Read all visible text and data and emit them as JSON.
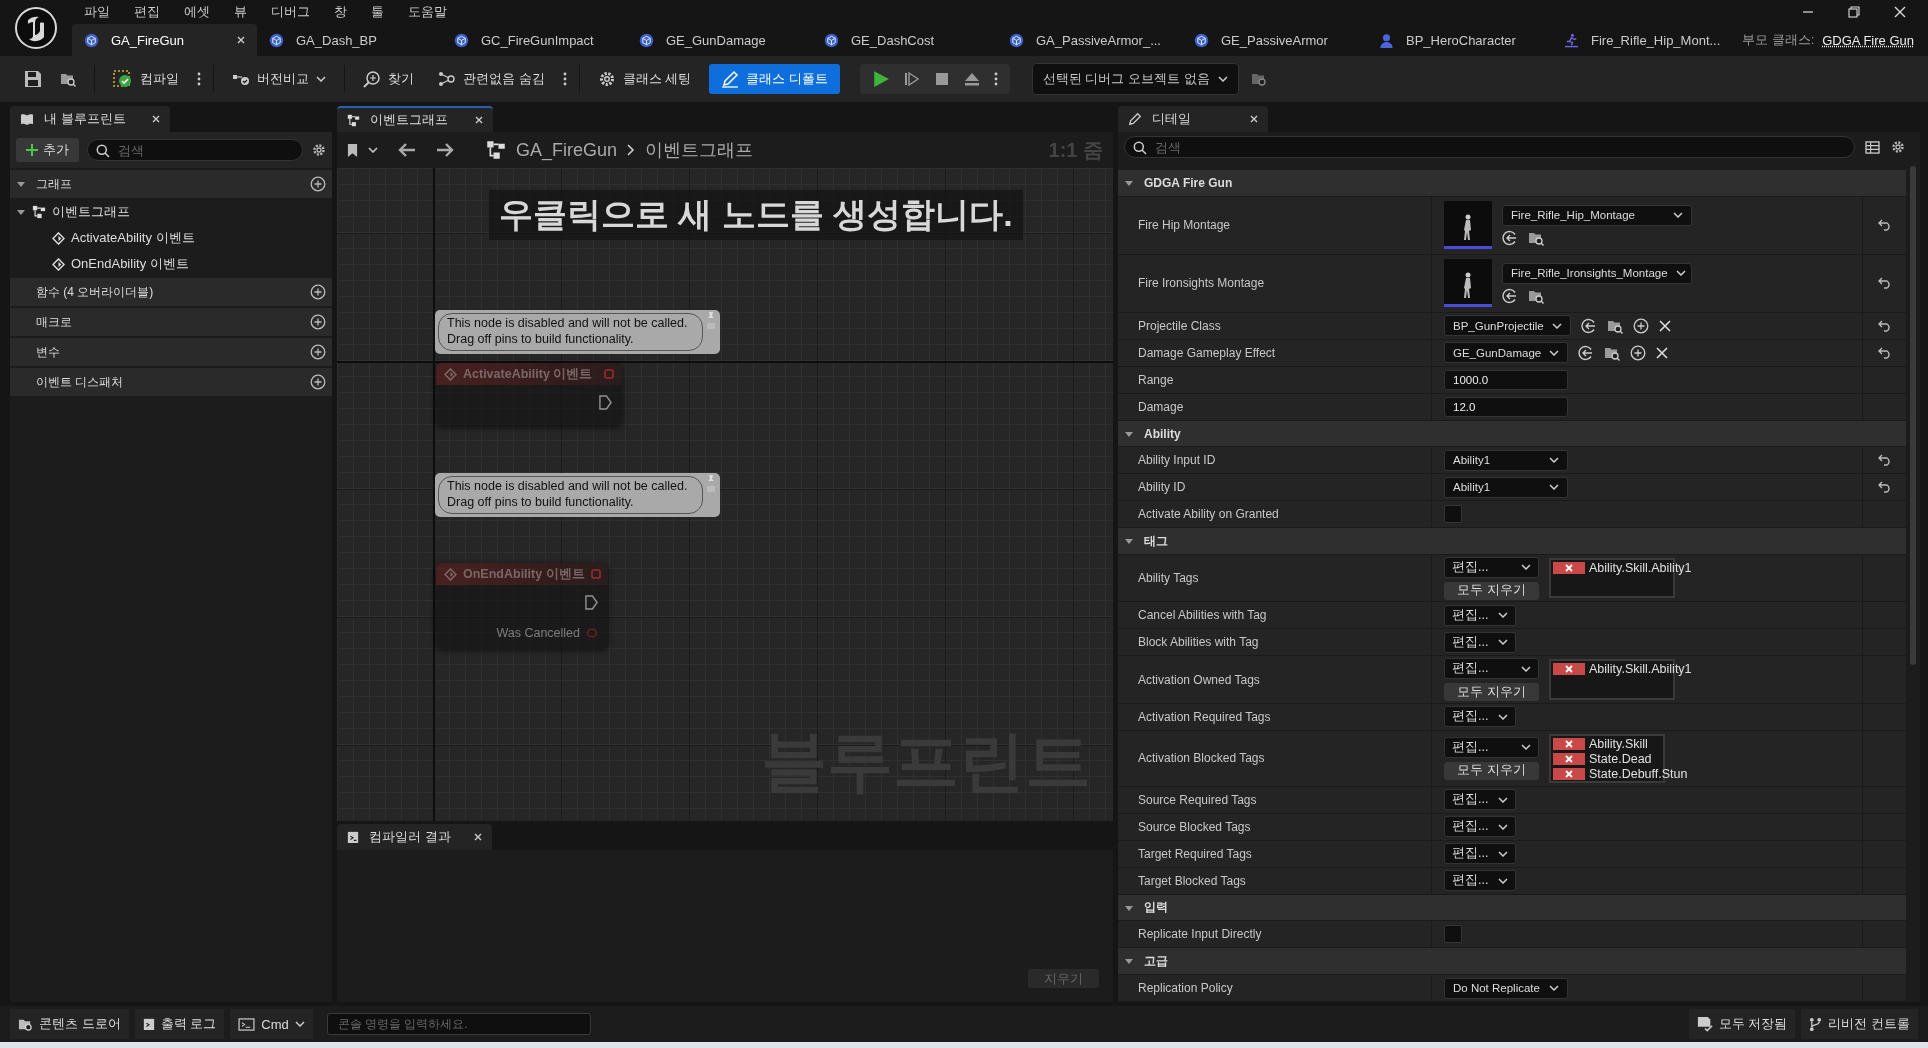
{
  "menu": [
    "파일",
    "편집",
    "에셋",
    "뷰",
    "디버그",
    "창",
    "툴",
    "도움말"
  ],
  "document_tabs": [
    {
      "label": "GA_FireGun",
      "kind": "blueprint",
      "selected": true
    },
    {
      "label": "GA_Dash_BP",
      "kind": "blueprint",
      "selected": false
    },
    {
      "label": "GC_FireGunImpact",
      "kind": "blueprint",
      "selected": false
    },
    {
      "label": "GE_GunDamage",
      "kind": "blueprint",
      "selected": false
    },
    {
      "label": "GE_DashCost",
      "kind": "blueprint",
      "selected": false
    },
    {
      "label": "GA_PassiveArmor_...",
      "kind": "blueprint",
      "selected": false
    },
    {
      "label": "GE_PassiveArmor",
      "kind": "blueprint",
      "selected": false
    },
    {
      "label": "BP_HeroCharacter",
      "kind": "character",
      "selected": false
    },
    {
      "label": "Fire_Rifle_Hip_Mont...",
      "kind": "montage",
      "selected": false
    }
  ],
  "parent_class": {
    "label": "부모 클래스:",
    "link": "GDGA Fire Gun"
  },
  "toolbar": {
    "compile": "컴파일",
    "diff": "버전비교",
    "find": "찾기",
    "hide_unrelated": "관련없음 숨김",
    "class_settings": "클래스 세팅",
    "class_defaults": {
      "label": "클래스 디폴트",
      "selected": true
    },
    "debug_object": "선택된 디버그 오브젝트 없음"
  },
  "my_blueprint": {
    "tab": "내 블루프린트",
    "add": "추가",
    "search_placeholder": "검색",
    "sections": [
      {
        "label": "그래프",
        "expanded": true,
        "children": [
          {
            "label": "이벤트그래프",
            "expanded": true,
            "children": [
              {
                "label": "ActivateAbility 이벤트"
              },
              {
                "label": "OnEndAbility 이벤트"
              }
            ]
          }
        ]
      },
      {
        "label": "함수 (4 오버라이더블)"
      },
      {
        "label": "매크로"
      },
      {
        "label": "변수"
      },
      {
        "label": "이벤트 디스패처"
      }
    ]
  },
  "graph": {
    "tab": "이벤트그래프",
    "breadcrumb": [
      "GA_FireGun",
      "이벤트그래프"
    ],
    "zoom": "1:1 줌",
    "hint": "우클릭으로 새 노드를 생성합니다.",
    "corner_label": "블루프린트",
    "nodes": [
      {
        "title": "ActivateAbility 이벤트",
        "comment": [
          "This node is disabled and will not be called.",
          "Drag off pins to build functionality."
        ],
        "disabled": true
      },
      {
        "title": "OnEndAbility 이벤트",
        "comment": [
          "This node is disabled and will not be called.",
          "Drag off pins to build functionality."
        ],
        "disabled": true,
        "pins": [
          "Was Cancelled"
        ]
      }
    ]
  },
  "compiler_results": {
    "tab": "컴파일러 결과",
    "clear": "지우기"
  },
  "details": {
    "tab": "디테일",
    "search_placeholder": "검색",
    "sections": [
      {
        "title": "GDGA Fire Gun",
        "expanded": true,
        "rows": [
          {
            "label": "Fire Hip Montage",
            "kind": "asset",
            "value": "Fire_Rifle_Hip_Montage",
            "resettable": true
          },
          {
            "label": "Fire Ironsights Montage",
            "kind": "asset",
            "value": "Fire_Rifle_Ironsights_Montage",
            "resettable": true
          },
          {
            "label": "Projectile Class",
            "kind": "class",
            "value": "BP_GunProjectile",
            "resettable": true
          },
          {
            "label": "Damage Gameplay Effect",
            "kind": "class",
            "value": "GE_GunDamage",
            "resettable": true
          },
          {
            "label": "Range",
            "kind": "number",
            "value": "1000.0",
            "resettable": false
          },
          {
            "label": "Damage",
            "kind": "number",
            "value": "12.0",
            "resettable": false
          }
        ]
      },
      {
        "title": "Ability",
        "expanded": true,
        "rows": [
          {
            "label": "Ability Input ID",
            "kind": "enum",
            "value": "Ability1",
            "resettable": true
          },
          {
            "label": "Ability ID",
            "kind": "enum",
            "value": "Ability1",
            "resettable": true
          },
          {
            "label": "Activate Ability on Granted",
            "kind": "checkbox",
            "checked": false,
            "resettable": false
          }
        ]
      },
      {
        "title": "태그",
        "expanded": true,
        "rows": [
          {
            "label": "Ability Tags",
            "kind": "tags",
            "edit": "편집...",
            "tags": [
              "Ability.Skill.Ability1"
            ],
            "clear": "모두 지우기",
            "resettable": false
          },
          {
            "label": "Cancel Abilities with Tag",
            "kind": "tags",
            "edit": "편집...",
            "resettable": false
          },
          {
            "label": "Block Abilities with Tag",
            "kind": "tags",
            "edit": "편집...",
            "resettable": false
          },
          {
            "label": "Activation Owned Tags",
            "kind": "tags",
            "edit": "편집...",
            "tags": [
              "Ability.Skill.Ability1"
            ],
            "clear": "모두 지우기",
            "resettable": false
          },
          {
            "label": "Activation Required Tags",
            "kind": "tags",
            "edit": "편집...",
            "resettable": false
          },
          {
            "label": "Activation Blocked Tags",
            "kind": "tags",
            "edit": "편집...",
            "tags": [
              "Ability.Skill",
              "State.Dead",
              "State.Debuff.Stun"
            ],
            "clear": "모두 지우기",
            "resettable": false
          },
          {
            "label": "Source Required Tags",
            "kind": "tags",
            "edit": "편집...",
            "resettable": false
          },
          {
            "label": "Source Blocked Tags",
            "kind": "tags",
            "edit": "편집...",
            "resettable": false
          },
          {
            "label": "Target Required Tags",
            "kind": "tags",
            "edit": "편집...",
            "resettable": false
          },
          {
            "label": "Target Blocked Tags",
            "kind": "tags",
            "edit": "편집...",
            "resettable": false
          }
        ]
      },
      {
        "title": "입력",
        "expanded": true,
        "rows": [
          {
            "label": "Replicate Input Directly",
            "kind": "checkbox",
            "checked": false,
            "resettable": false
          }
        ]
      },
      {
        "title": "고급",
        "expanded": true,
        "rows": [
          {
            "label": "Replication Policy",
            "kind": "enum",
            "value": "Do Not Replicate",
            "resettable": false
          }
        ]
      }
    ]
  },
  "status_bar": {
    "content_drawer": "콘텐츠 드로어",
    "output_log": "출력 로그",
    "cmd": "Cmd",
    "console_placeholder": "콘솔 명령을 입력하세요.",
    "save_all": "모두 저장됨",
    "revision_control": "리비전 컨트롤"
  }
}
